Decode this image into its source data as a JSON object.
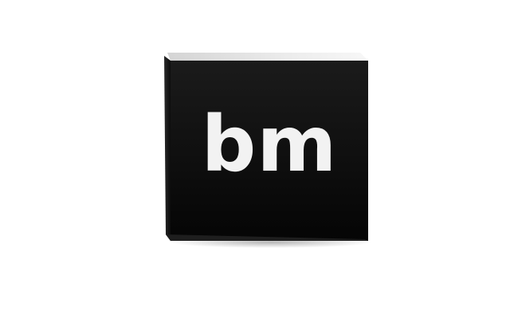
{
  "logo": {
    "text": "bm",
    "icon": "bm-book-logo-icon",
    "colors": {
      "face": "#111111",
      "face_gradient_top": "#1b1b1b",
      "text": "#f2f2f2",
      "pages_edge": "#e2e2e2",
      "spine_edge": "#3a3a3a",
      "background": "#ffffff"
    }
  }
}
